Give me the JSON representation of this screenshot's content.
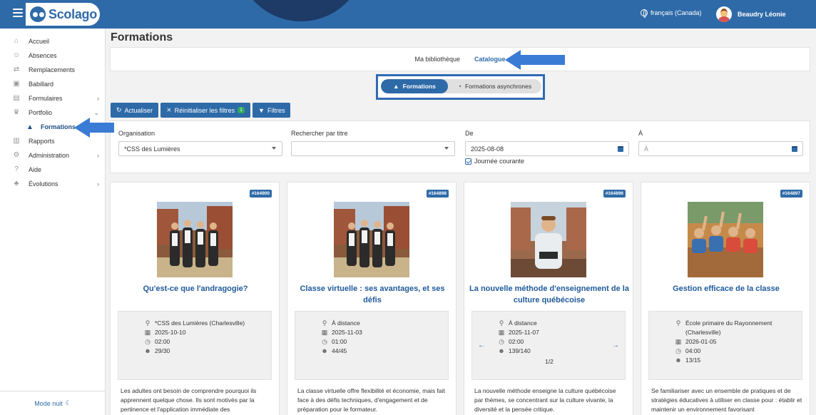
{
  "header": {
    "brand": "Scolago",
    "language": "français (Canada)",
    "user_name": "Beaudry Léonie"
  },
  "sidebar": {
    "items": [
      {
        "label": "Accueil",
        "icon": "home-icon",
        "glyph": "⌂"
      },
      {
        "label": "Absences",
        "icon": "person-absent-icon",
        "glyph": "☺"
      },
      {
        "label": "Remplacements",
        "icon": "swap-icon",
        "glyph": "⇄"
      },
      {
        "label": "Babillard",
        "icon": "board-icon",
        "glyph": "▣"
      },
      {
        "label": "Formulaires",
        "icon": "form-icon",
        "glyph": "▤"
      },
      {
        "label": "Portfolio",
        "icon": "trophy-icon",
        "glyph": "♛"
      },
      {
        "label": "Formations",
        "icon": "graduation-cap-icon",
        "glyph": "🎓"
      },
      {
        "label": "Rapports",
        "icon": "report-icon",
        "glyph": "▥"
      },
      {
        "label": "Administration",
        "icon": "gear-icon",
        "glyph": "⚙"
      },
      {
        "label": "Aide",
        "icon": "question-icon",
        "glyph": "?"
      },
      {
        "label": "Évolutions",
        "icon": "sprout-icon",
        "glyph": "♣"
      }
    ],
    "mode_nuit": "Mode nuit"
  },
  "main": {
    "title": "Formations",
    "subnav": {
      "library": "Ma bibliothèque",
      "catalog": "Catalogue"
    },
    "toggle": {
      "formations": "Formations",
      "async": "Formations asynchrones"
    },
    "toolbar": {
      "refresh": "Actualiser",
      "reset": "Réinitialiser les filtres",
      "reset_count": "1",
      "filters": "Filtres"
    },
    "filters": {
      "org_label": "Organisation",
      "org_value": "*CSS des Lumières",
      "title_label": "Rechercher par titre",
      "title_value": "",
      "from_label": "De",
      "from_value": "2025-08-08",
      "to_label": "À",
      "to_placeholder": "À",
      "current_day": "Journée courante"
    }
  },
  "cards": [
    {
      "id": "#164900",
      "title": "Qu'est-ce que l'andragogie?",
      "location": "*CSS des Lumières (Charlesville)",
      "date": "2025-10-10",
      "duration": "02:00",
      "seats": "29/30",
      "description": "Les adultes ont besoin de comprendre pourquoi ils apprennent quelque chose. Ils sont motivés par la pertinence et l'application immédiate des"
    },
    {
      "id": "#164898",
      "title": "Classe virtuelle : ses avantages, et ses défis",
      "location": "À distance",
      "date": "2025-11-03",
      "duration": "01:00",
      "seats": "44/45",
      "description": "La classe virtuelle offre flexibilité et économie, mais fait face à des défis techniques, d'engagement et de préparation pour le formateur."
    },
    {
      "id": "#164896",
      "title": "La nouvelle méthode d'enseignement de la culture québécoise",
      "location": "À distance",
      "date": "2025-11-07",
      "duration": "02:00",
      "seats": "139/140",
      "pager": "1/2",
      "description": "La nouvelle méthode enseigne la culture québécoise par thèmes, se concentrant sur la culture vivante, la diversité et la pensée critique."
    },
    {
      "id": "#164897",
      "title": "Gestion efficace de la classe",
      "location": "École primaire du Rayonnement (Charlesville)",
      "date": "2026-01-05",
      "duration": "04:00",
      "seats": "13/15",
      "description": "Se familiariser avec un ensemble de pratiques et de stratégies éducatives à utiliser en classe pour : établir et maintenir un environnement favorisant"
    }
  ],
  "colors": {
    "primary": "#2e6aa8",
    "title_blue": "#1f5a9a",
    "badge_green": "#2eaa5c",
    "annotation_blue": "#3a7bd5"
  }
}
